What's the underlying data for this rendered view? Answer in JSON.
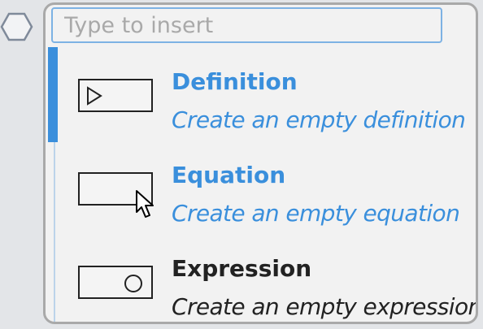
{
  "search": {
    "placeholder": "Type to insert",
    "value": ""
  },
  "items": [
    {
      "title": "Definition",
      "description": "Create an empty definition",
      "icon": "play-triangle-icon",
      "selected": true
    },
    {
      "title": "Equation",
      "description": "Create an empty equation",
      "icon": "empty-box-icon",
      "hovered": true
    },
    {
      "title": "Expression",
      "description": "Create an empty expression",
      "icon": "circle-icon"
    }
  ],
  "colors": {
    "accent": "#3b8fdc",
    "text_blue": "#3a8fdc",
    "text_dark": "#222222",
    "border": "#a9a9a9",
    "background": "#f2f2f2"
  }
}
